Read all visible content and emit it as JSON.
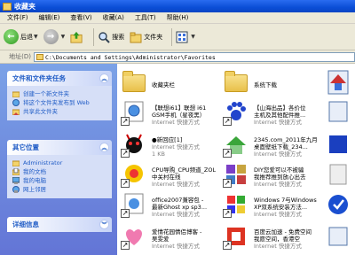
{
  "window": {
    "title": "收藏夹"
  },
  "menu": [
    "文件(F)",
    "编辑(E)",
    "查看(V)",
    "收藏(A)",
    "工具(T)",
    "帮助(H)"
  ],
  "toolbar": {
    "back_label": "后退",
    "search_label": "搜索",
    "folders_label": "文件夹"
  },
  "address": {
    "label": "地址(D)",
    "value": "C:\\Documents and Settings\\Administrator\\Favorites"
  },
  "left_panel": {
    "tasks": {
      "title": "文件和文件夹任务",
      "links": [
        "创建一个新文件夹",
        "将这个文件夹发布到 Web",
        "共享此文件夹"
      ]
    },
    "places": {
      "title": "其它位置",
      "links": [
        "Administrator",
        "我的文档",
        "我的电脑",
        "网上邻居"
      ]
    },
    "details": {
      "title": "详细信息"
    }
  },
  "items": [
    {
      "name": "收藏夹栏",
      "type": "",
      "icon": "folder-icon"
    },
    {
      "name": "系统下载",
      "type": "",
      "icon": "folder-icon"
    },
    {
      "name": "",
      "type": "",
      "icon": "shortcut-icon"
    },
    {
      "name": "【联想i61】联想 i61",
      "name2": "GSM手机（星夜黑）",
      "type": "Internet 快捷方式",
      "icon": "internet-shortcut-icon"
    },
    {
      "name": "【山海出品】各价位",
      "name2": "主机及其他配件推...",
      "type": "Internet 快捷方式",
      "icon": "paw-shortcut-icon"
    },
    {
      "name": "",
      "type": "",
      "icon": "shortcut-icon"
    },
    {
      "name": "●新回应[1]",
      "name2": "Internet 快捷方式",
      "type": "1 KB",
      "icon": "devil-shortcut-icon"
    },
    {
      "name": "2345.com_2011年九月",
      "name2": "桌面壁纸下载_234...",
      "type": "Internet 快捷方式",
      "icon": "web-shortcut-icon"
    },
    {
      "name": "",
      "type": "",
      "icon": "shortcut-icon"
    },
    {
      "name": "CPU导购_CPU频道_ZOL",
      "name2": "中关村在线",
      "type": "Internet 快捷方式",
      "icon": "zol-shortcut-icon"
    },
    {
      "name": "DIY您爱可以不被骗",
      "name2": "我推荐推到放心出去",
      "type": "Internet 快捷方式",
      "icon": "diy-shortcut-icon"
    },
    {
      "name": "",
      "type": "",
      "icon": "shortcut-icon"
    },
    {
      "name": "office2007兼容包 -",
      "name2": "最新Ghost xp sp3...",
      "type": "Internet 快捷方式",
      "icon": "office-shortcut-icon"
    },
    {
      "name": "Windows 7与Windows",
      "name2": "XP双系统安装方法...",
      "type": "Internet 快捷方式",
      "icon": "windows-shortcut-icon"
    },
    {
      "name": "",
      "type": "",
      "icon": "shortcut-icon"
    },
    {
      "name": "爱情花园情侣博客 -",
      "name2": "吴雯爱",
      "type": "Internet 快捷方式",
      "icon": "heart-shortcut-icon"
    },
    {
      "name": "百度云加速 - 免费空间",
      "name2": "我愿空间，香港空",
      "type": "Internet 快捷方式",
      "icon": "red-shortcut-icon"
    },
    {
      "name": "",
      "type": "",
      "icon": "shortcut-icon"
    }
  ]
}
